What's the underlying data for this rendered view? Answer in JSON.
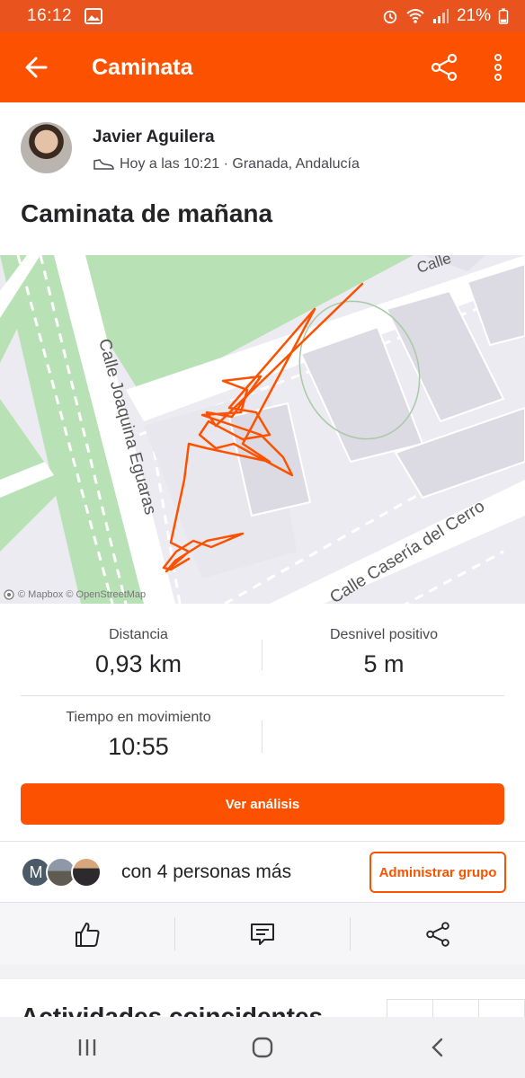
{
  "status_bar": {
    "time": "16:12",
    "battery": "21%"
  },
  "app_bar": {
    "title": "Caminata",
    "back_icon": "arrow-left-icon",
    "share_icon": "share-icon",
    "menu_icon": "more-vertical-icon"
  },
  "header": {
    "athlete_name": "Javier Aguilera",
    "activity_meta": "Hoy a las 10:21 · Granada, Andalucía",
    "activity_title": "Caminata de mañana"
  },
  "map": {
    "streets": [
      "Calle Joaquina Eguaras",
      "Calle Casería del Cerro",
      "Calle"
    ],
    "attribution": "© Mapbox © OpenStreetMap",
    "route_color": "#fc5200"
  },
  "stats": {
    "distance_label": "Distancia",
    "distance_value": "0,93 km",
    "elevation_label": "Desnivel positivo",
    "elevation_value": "5 m",
    "moving_time_label": "Tiempo en movimiento",
    "moving_time_value": "10:55"
  },
  "analysis_button": "Ver análisis",
  "group": {
    "first_initial": "M",
    "text": "con 4 personas más",
    "admin_button": "Administrar grupo"
  },
  "actions": {
    "kudos_icon": "thumbs-up-icon",
    "comment_icon": "comment-icon",
    "share_icon": "share-icon"
  },
  "section": {
    "title": "Actividades coincidentes"
  },
  "colors": {
    "brand": "#fc5200",
    "status_bar": "#e8531e",
    "text": "#242428",
    "map_green": "#b6e3b5"
  }
}
